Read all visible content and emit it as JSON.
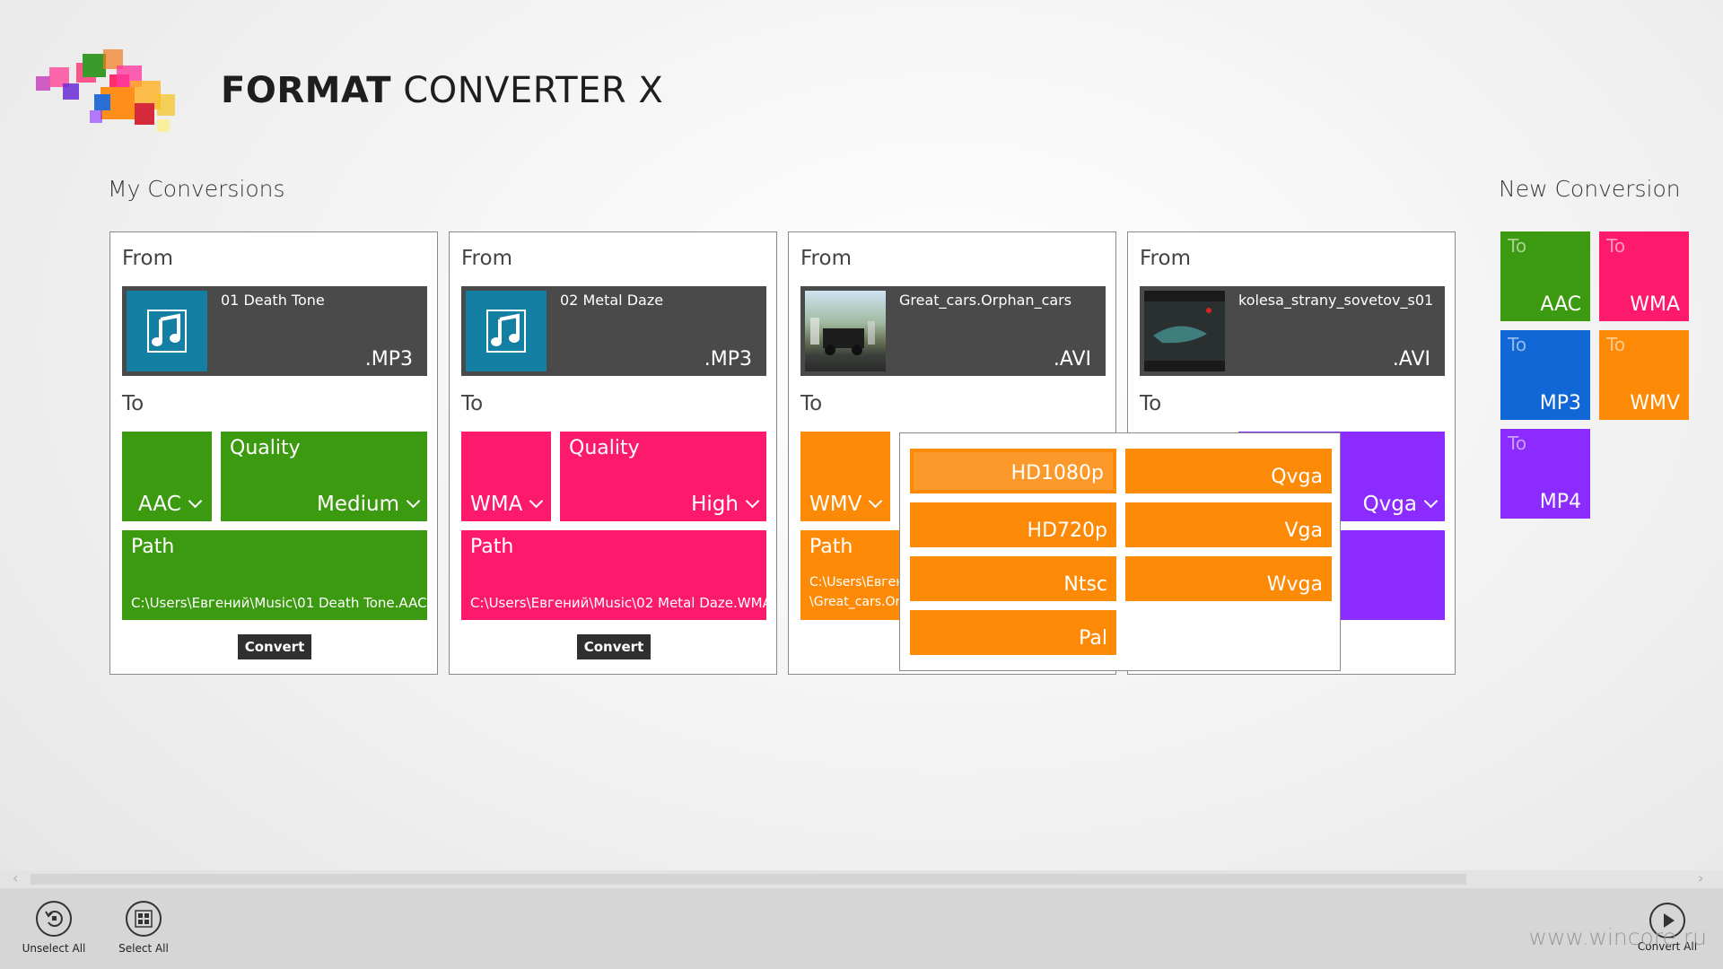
{
  "app": {
    "title_bold": "FORMAT",
    "title_light": "CONVERTER X"
  },
  "sections": {
    "my_conversions": "My Conversions",
    "new_conversion": "New Conversion"
  },
  "labels": {
    "from": "From",
    "to": "To",
    "quality": "Quality",
    "path": "Path",
    "convert": "Convert"
  },
  "cards": [
    {
      "file": "01 Death Tone",
      "ext": ".MP3",
      "format": "AAC",
      "quality": "Medium",
      "path": "C:\\Users\\Евгений\\Music\\01 Death Tone.AAC",
      "color": "#3c9a11"
    },
    {
      "file": "02 Metal Daze",
      "ext": ".MP3",
      "format": "WMA",
      "quality": "High",
      "path": "C:\\Users\\Евгений\\Music\\02 Metal Daze.WMA",
      "color": "#fd1a6c"
    },
    {
      "file": "Great_cars.Orphan_cars",
      "ext": ".AVI",
      "format": "WMV",
      "path_line1": "C:\\Users\\Евген",
      "path_line2": "\\Great_cars.Or",
      "color": "#fd8a06"
    },
    {
      "file": "kolesa_strany_sovetov_s01",
      "ext": ".AVI",
      "quality": "Qvga",
      "color": "#8b2bff"
    }
  ],
  "quality_options": {
    "left": [
      "HD1080p",
      "HD720p",
      "Ntsc",
      "Pal"
    ],
    "right": [
      "Qvga",
      "Vga",
      "Wvga"
    ],
    "selected": "HD1080p"
  },
  "new_conversion_tiles": [
    {
      "to": "To",
      "format": "AAC",
      "color": "#3c9a11"
    },
    {
      "to": "To",
      "format": "WMA",
      "color": "#fd1a6c"
    },
    {
      "to": "To",
      "format": "MP3",
      "color": "#1167d6"
    },
    {
      "to": "To",
      "format": "WMV",
      "color": "#fd8a06"
    },
    {
      "to": "To",
      "format": "MP4",
      "color": "#8b2bff"
    }
  ],
  "appbar": {
    "unselect_all": "Unselect All",
    "select_all": "Select All",
    "convert_all": "Convert All"
  },
  "icons": {
    "undo": "undo-icon",
    "select_all": "select-all-icon",
    "play": "play-icon",
    "music": "music-note-icon",
    "chevron": "chevron-down-icon"
  },
  "watermark": "www.wincore.ru"
}
